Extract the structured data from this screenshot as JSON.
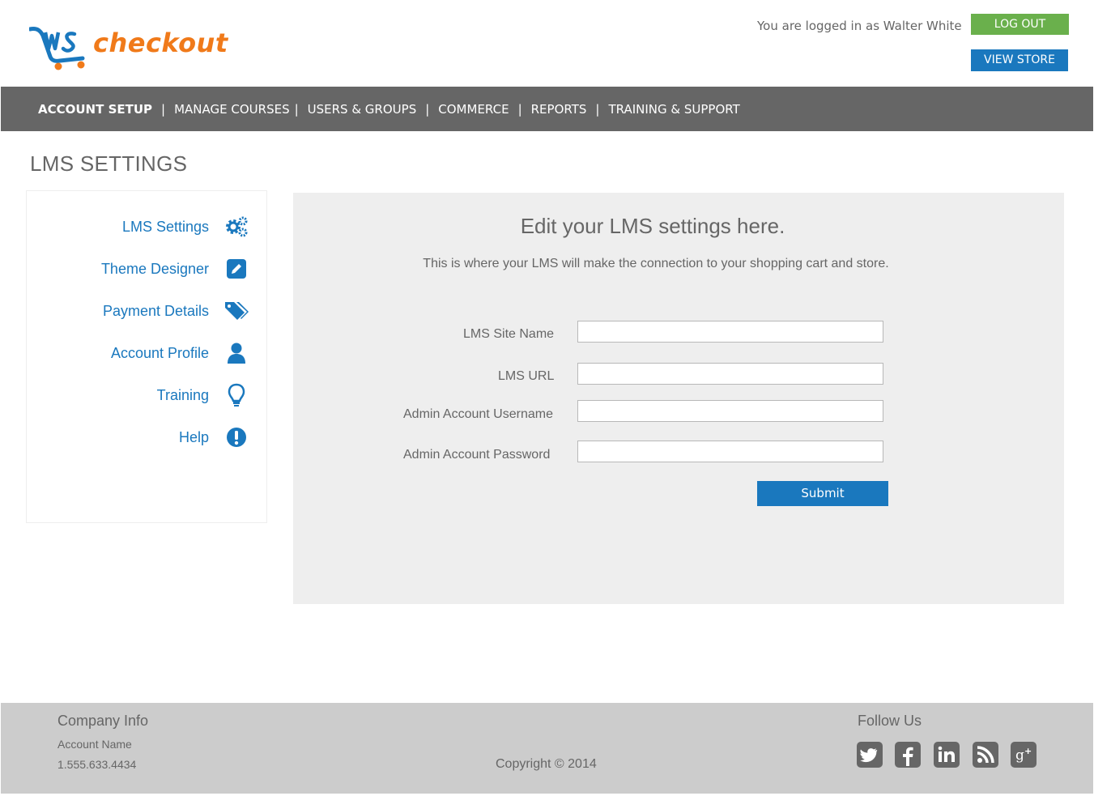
{
  "header": {
    "logo_text": "checkout",
    "logo_mark": "LMS",
    "logged_in_text": "You are logged in as Walter White",
    "logout_label": "LOG OUT",
    "view_store_label": "VIEW STORE"
  },
  "nav": {
    "items": [
      {
        "label": "ACCOUNT SETUP",
        "active": true
      },
      {
        "label": "MANAGE COURSES"
      },
      {
        "label": "USERS & GROUPS"
      },
      {
        "label": "COMMERCE"
      },
      {
        "label": "REPORTS"
      },
      {
        "label": "TRAINING & SUPPORT"
      }
    ],
    "separator": "|"
  },
  "page": {
    "title": "LMS SETTINGS"
  },
  "sidebar": {
    "items": [
      {
        "label": "LMS Settings",
        "icon": "gears-icon"
      },
      {
        "label": "Theme Designer",
        "icon": "pencil-icon"
      },
      {
        "label": "Payment Details",
        "icon": "tags-icon"
      },
      {
        "label": "Account Profile",
        "icon": "user-icon"
      },
      {
        "label": "Training",
        "icon": "lightbulb-icon"
      },
      {
        "label": "Help",
        "icon": "exclamation-icon"
      }
    ]
  },
  "panel": {
    "title": "Edit your LMS settings here.",
    "subtitle": "This is where your LMS will make the connection to your shopping cart and store.",
    "fields": [
      {
        "label": "LMS Site Name",
        "value": "",
        "placeholder": ""
      },
      {
        "label": "LMS URL",
        "value": "",
        "placeholder": ""
      },
      {
        "label": "Admin Account Username",
        "value": "",
        "placeholder": ""
      },
      {
        "label": "Admin Account Password",
        "value": "",
        "placeholder": ""
      }
    ],
    "submit_label": "Submit"
  },
  "footer": {
    "company_heading": "Company Info",
    "account_name": "Account Name",
    "phone": "1.555.633.4434",
    "copyright": "Copyright © 2014",
    "follow_heading": "Follow Us",
    "social": [
      "twitter-icon",
      "facebook-icon",
      "linkedin-icon",
      "rss-icon",
      "google-plus-icon"
    ]
  },
  "colors": {
    "brand_blue": "#1a78be",
    "brand_orange": "#f07a1a",
    "logout_green": "#6ab04c",
    "nav_gray": "#666666",
    "panel_gray": "#eeeeee",
    "footer_gray": "#cccccc"
  }
}
